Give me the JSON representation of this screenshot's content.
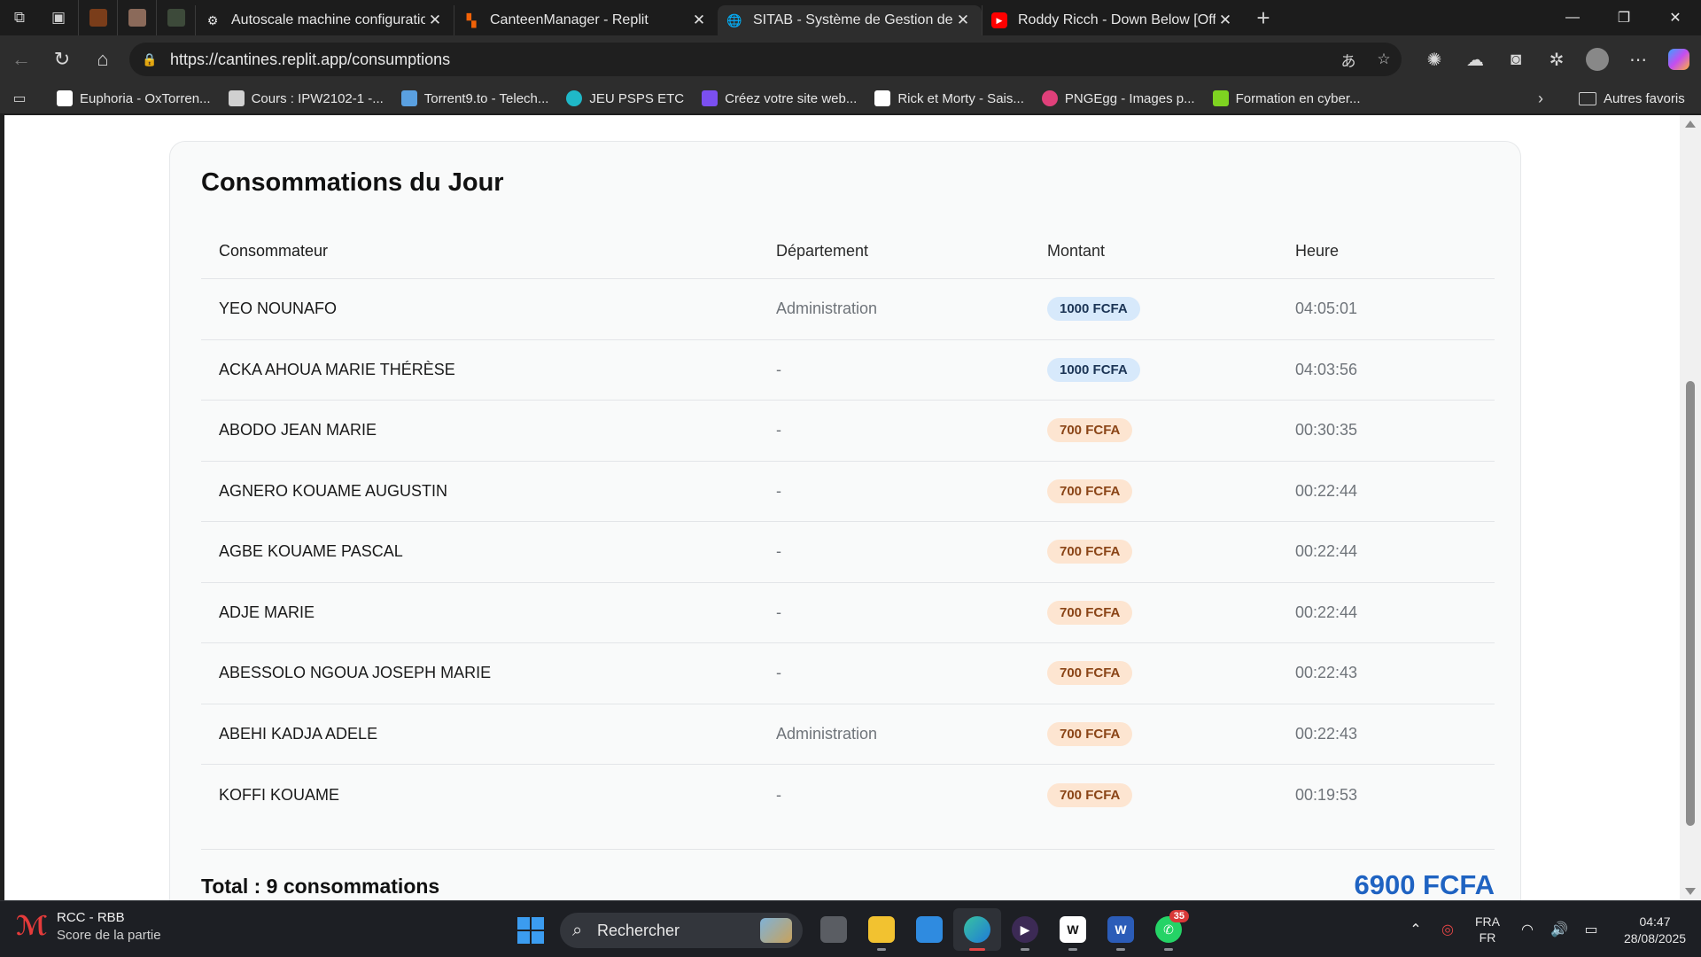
{
  "browser": {
    "tabs": [
      {
        "title": "Autoscale machine configuration",
        "favicon": "gear-icon",
        "active": false
      },
      {
        "title": "CanteenManager - Replit",
        "favicon": "replit-icon",
        "active": false
      },
      {
        "title": "SITAB - Système de Gestion de Ca",
        "favicon": "globe-icon",
        "active": true
      },
      {
        "title": "Roddy Ricch - Down Below [Offici",
        "favicon": "youtube-icon",
        "active": false
      }
    ],
    "url": "https://cantines.replit.app/consumptions",
    "bookmarks": [
      {
        "label": "Euphoria - OxTorren...",
        "color": "#ffffff"
      },
      {
        "label": "Cours : IPW2102-1 -...",
        "color": "#d0d0d0"
      },
      {
        "label": "Torrent9.to - Telech...",
        "color": "#5aa0e0"
      },
      {
        "label": "JEU PSPS ETC",
        "color": "#1fb8c8"
      },
      {
        "label": "Créez votre site web...",
        "color": "#7b4ff0"
      },
      {
        "label": "Rick et Morty - Sais...",
        "color": "#ffffff"
      },
      {
        "label": "PNGEgg - Images p...",
        "color": "#e0407a"
      },
      {
        "label": "Formation en cyber...",
        "color": "#7ed321"
      }
    ],
    "other_favorites": "Autres favoris"
  },
  "page": {
    "title": "Consommations du Jour",
    "columns": [
      "Consommateur",
      "Département",
      "Montant",
      "Heure"
    ],
    "rows": [
      {
        "name": "YEO NOUNAFO",
        "department": "Administration",
        "amount": "1000 FCFA",
        "badge": "blue",
        "time": "04:05:01"
      },
      {
        "name": "ACKA AHOUA MARIE THÉRÈSE",
        "department": "-",
        "amount": "1000 FCFA",
        "badge": "blue",
        "time": "04:03:56"
      },
      {
        "name": "ABODO JEAN MARIE",
        "department": "-",
        "amount": "700 FCFA",
        "badge": "orange",
        "time": "00:30:35"
      },
      {
        "name": "AGNERO KOUAME AUGUSTIN",
        "department": "-",
        "amount": "700 FCFA",
        "badge": "orange",
        "time": "00:22:44"
      },
      {
        "name": "AGBE KOUAME PASCAL",
        "department": "-",
        "amount": "700 FCFA",
        "badge": "orange",
        "time": "00:22:44"
      },
      {
        "name": "ADJE MARIE",
        "department": "-",
        "amount": "700 FCFA",
        "badge": "orange",
        "time": "00:22:44"
      },
      {
        "name": "ABESSOLO NGOUA JOSEPH MARIE",
        "department": "-",
        "amount": "700 FCFA",
        "badge": "orange",
        "time": "00:22:43"
      },
      {
        "name": "ABEHI KADJA ADELE",
        "department": "Administration",
        "amount": "700 FCFA",
        "badge": "orange",
        "time": "00:22:43"
      },
      {
        "name": "KOFFI KOUAME",
        "department": "-",
        "amount": "700 FCFA",
        "badge": "orange",
        "time": "00:19:53"
      }
    ],
    "total_label": "Total : 9 consommations",
    "total_amount": "6900 FCFA",
    "accent": "#1f63c2"
  },
  "taskbar": {
    "widget_title": "RCC - RBB",
    "widget_subtitle": "Score de la partie",
    "search_placeholder": "Rechercher",
    "whatsapp_badge": "35",
    "lang_top": "FRA",
    "lang_bottom": "FR",
    "time": "04:47",
    "date": "28/08/2025"
  }
}
